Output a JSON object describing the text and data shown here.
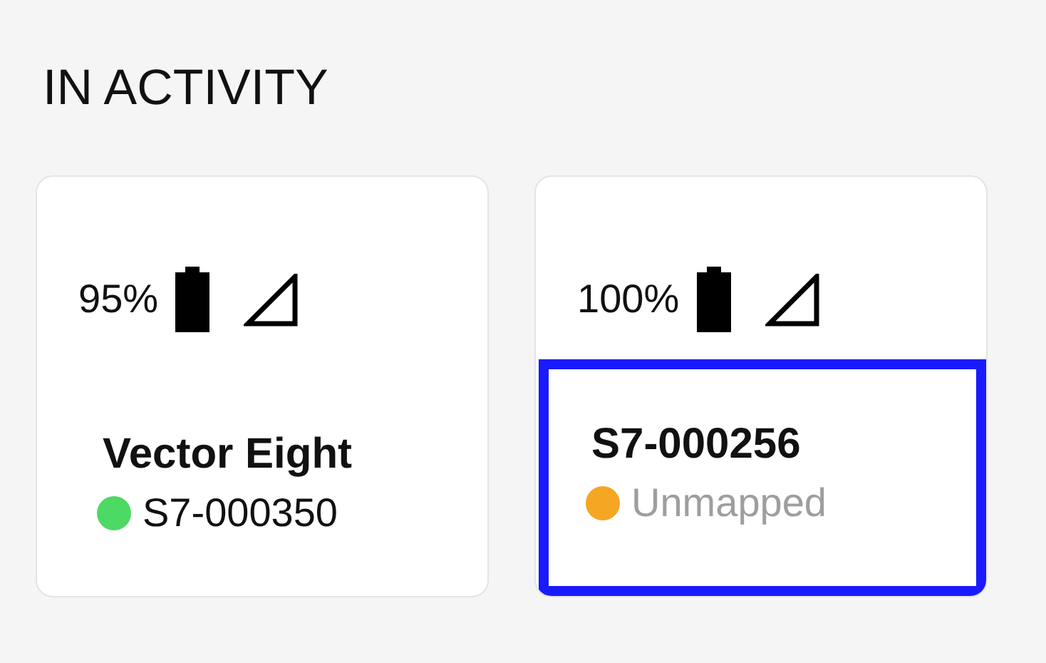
{
  "section_title": "IN ACTIVITY",
  "devices": [
    {
      "battery": "95%",
      "name": "Vector Eight",
      "color": "#4cd964",
      "subtitle": "S7-000350",
      "muted": false,
      "selected": false
    },
    {
      "battery": "100%",
      "name": "S7-000256",
      "color": "#f5a623",
      "subtitle": "Unmapped",
      "muted": true,
      "selected": true
    }
  ]
}
